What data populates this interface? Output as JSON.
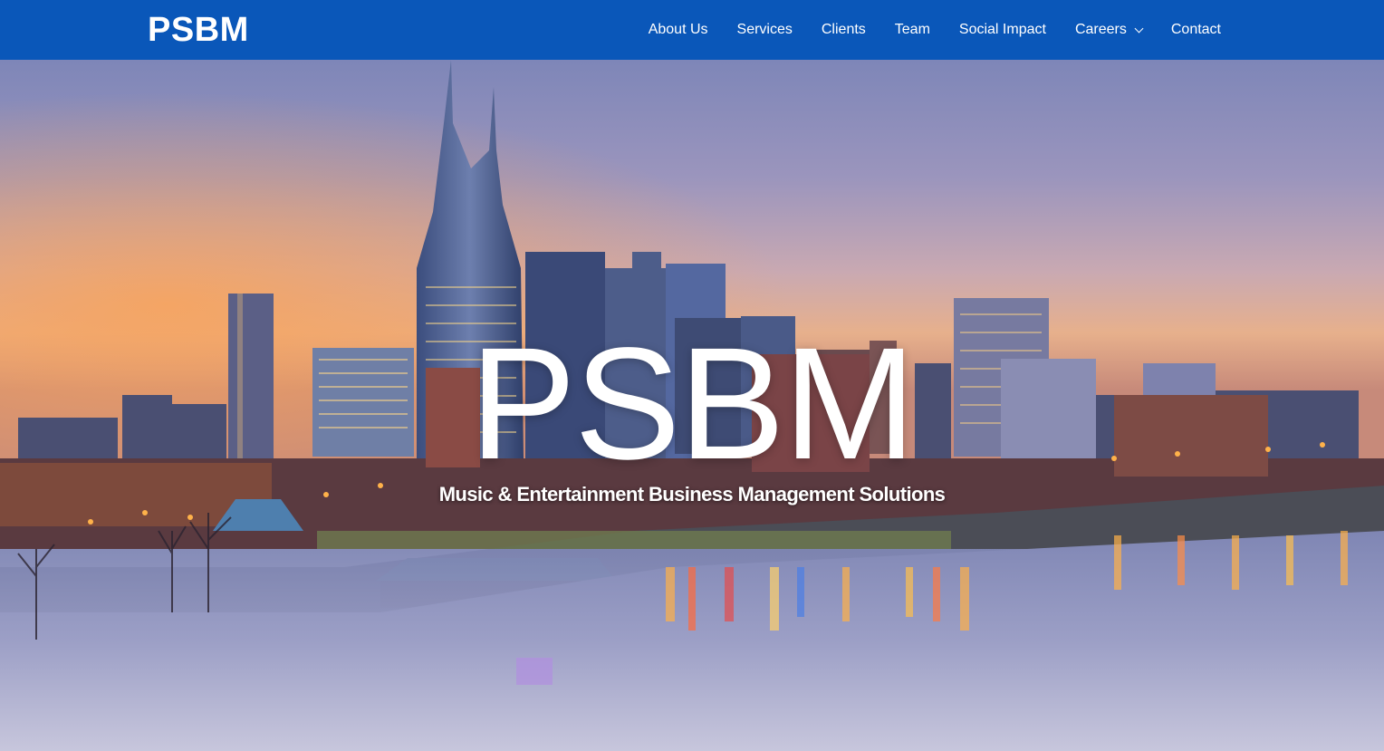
{
  "header": {
    "logo": "PSBM",
    "background_color": "#0a57b9",
    "nav": [
      {
        "label": "About Us"
      },
      {
        "label": "Services"
      },
      {
        "label": "Clients"
      },
      {
        "label": "Team"
      },
      {
        "label": "Social Impact"
      },
      {
        "label": "Careers",
        "icon": "chevron-down-icon"
      },
      {
        "label": "Contact"
      }
    ]
  },
  "hero": {
    "title": "PSBM",
    "subtitle": "Music & Entertainment Business Management Solutions",
    "background_image": "nashville-skyline-at-dusk"
  }
}
